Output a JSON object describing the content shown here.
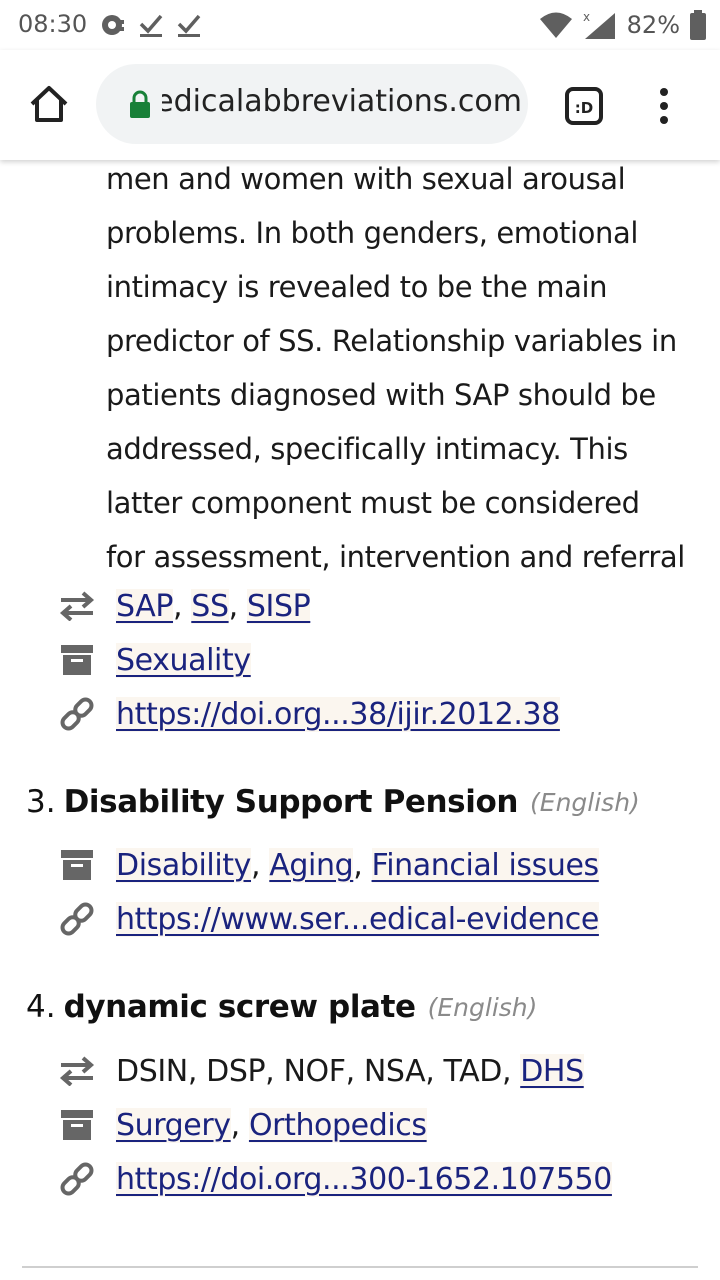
{
  "status_bar": {
    "time": "08:30",
    "battery": "82%"
  },
  "browser": {
    "url": "edicalabbreviations.com",
    "tabs_label": ":D"
  },
  "abstract_lines": [
    "men and women with sexual arousal",
    "problems. In both genders, emotional",
    "intimacy is revealed to be the main",
    "predictor of SS. Relationship variables in",
    "patients diagnosed with SAP should be",
    "addressed, specifically intimacy. This",
    "latter component must be considered",
    "for assessment, intervention and referral"
  ],
  "entry2": {
    "related": [
      "SAP",
      "SS",
      "SISP"
    ],
    "categories": [
      "Sexuality"
    ],
    "link": "https://doi.org...38/ijir.2012.38"
  },
  "entry3": {
    "number": "3.",
    "title": "Disability Support Pension",
    "language": "(English)",
    "categories": [
      "Disability",
      "Aging",
      "Financial issues"
    ],
    "link": "https://www.ser...edical-evidence"
  },
  "entry4": {
    "number": "4.",
    "title": "dynamic screw plate",
    "language": "(English)",
    "related_plain": [
      "DSIN",
      "DSP",
      "NOF",
      "NSA",
      "TAD"
    ],
    "related_links": [
      "DHS"
    ],
    "categories": [
      "Surgery",
      "Orthopedics"
    ],
    "link": "https://doi.org...300-1652.107550"
  },
  "sep": ", "
}
